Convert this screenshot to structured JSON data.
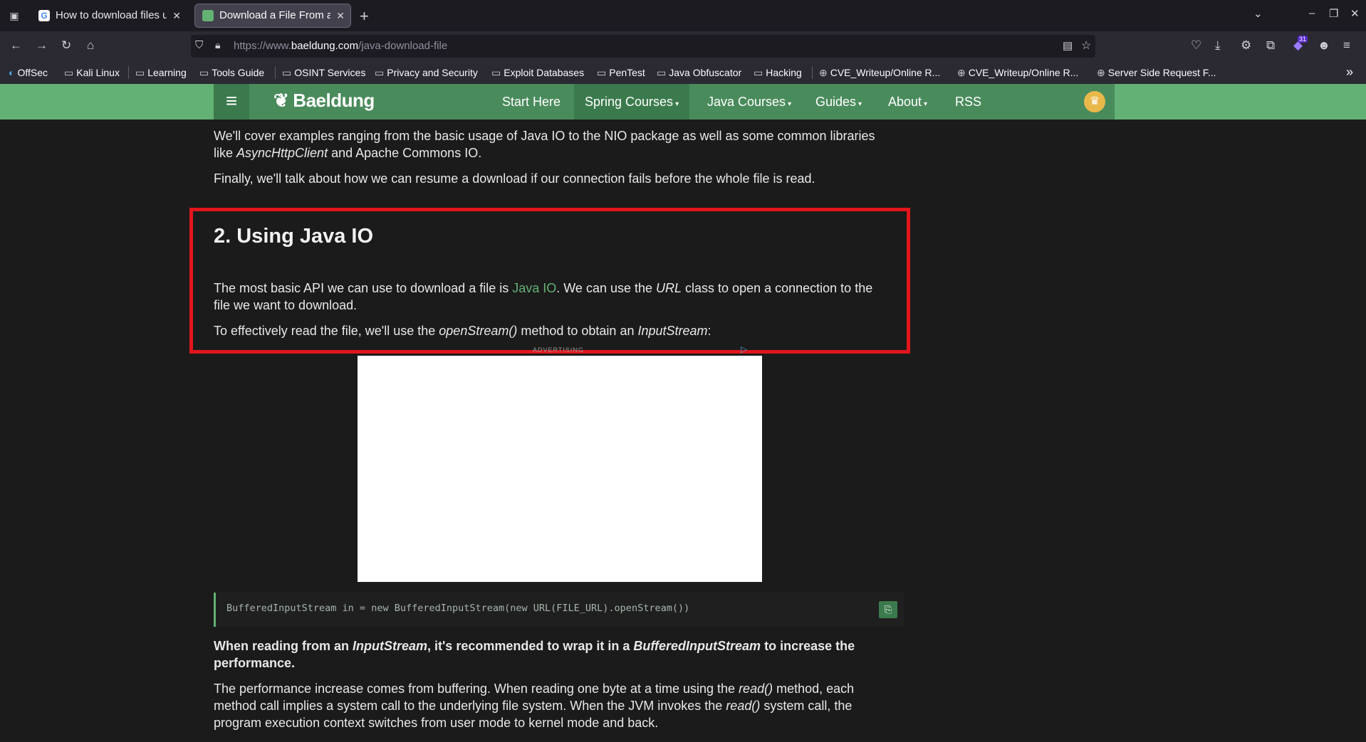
{
  "browser": {
    "tabs": [
      {
        "title": "How to download files us",
        "active": false
      },
      {
        "title": "Download a File From an",
        "active": true
      }
    ],
    "url_prefix": "https://www.",
    "url_domain": "baeldung.com",
    "url_path": "/java-download-file",
    "extension_badge": "31",
    "bookmarks": [
      "OffSec",
      "Kali Linux",
      "Learning",
      "Tools Guide",
      "OSINT Services",
      "Privacy and Security",
      "Exploit Databases",
      "PenTest",
      "Java Obfuscator",
      "Hacking",
      "CVE_Writeup/Online R...",
      "CVE_Writeup/Online R...",
      "Server Side Request F..."
    ]
  },
  "site": {
    "logo": "Baeldung",
    "menu": [
      "Start Here",
      "Spring Courses",
      "Java Courses",
      "Guides",
      "About",
      "RSS"
    ]
  },
  "article": {
    "intro_1": "We'll cover examples ranging from the basic usage of Java IO to the NIO package as well as some common libraries",
    "intro_2_pre": "like ",
    "intro_2_em": "AsyncHttpClient",
    "intro_2_post": " and Apache Commons IO.",
    "intro_3": "Finally, we'll talk about how we can resume a download if our connection fails before the whole file is read.",
    "heading": "2. Using Java IO",
    "p1_pre": "The most basic API we can use to download a file is ",
    "p1_link": "Java IO",
    "p1_mid": ". We can use the ",
    "p1_em": "URL",
    "p1_post": " class to open a connection to the",
    "p1_line2": "file we want to download.",
    "p2_pre": "To effectively read the file, we'll use the ",
    "p2_em1": "openStream()",
    "p2_mid": " method to obtain an ",
    "p2_em2": "InputStream",
    "p2_post": ":",
    "ad_label": "ADVERTISING",
    "code": "BufferedInputStream in = new BufferedInputStream(new URL(FILE_URL).openStream())",
    "b_pre": "When reading from an ",
    "b_em1": "InputStream",
    "b_mid": ", it's recommended to wrap it in a ",
    "b_em2": "BufferedInputStream",
    "b_post": " to increase the",
    "b_line2": "performance.",
    "p3_1_pre": "The performance increase comes from buffering. When reading one byte at a time using the ",
    "p3_1_em": "read()",
    "p3_1_post": " method, each",
    "p3_2_pre": "method call implies a system call to the underlying file system. When the JVM invokes the ",
    "p3_2_em": "read()",
    "p3_2_post": " system call, the",
    "p3_3": "program execution context switches from user mode to kernel mode and back."
  },
  "colors": {
    "accent": "#63b175",
    "highlight": "#e3151c",
    "header": "#4a8b5c"
  }
}
